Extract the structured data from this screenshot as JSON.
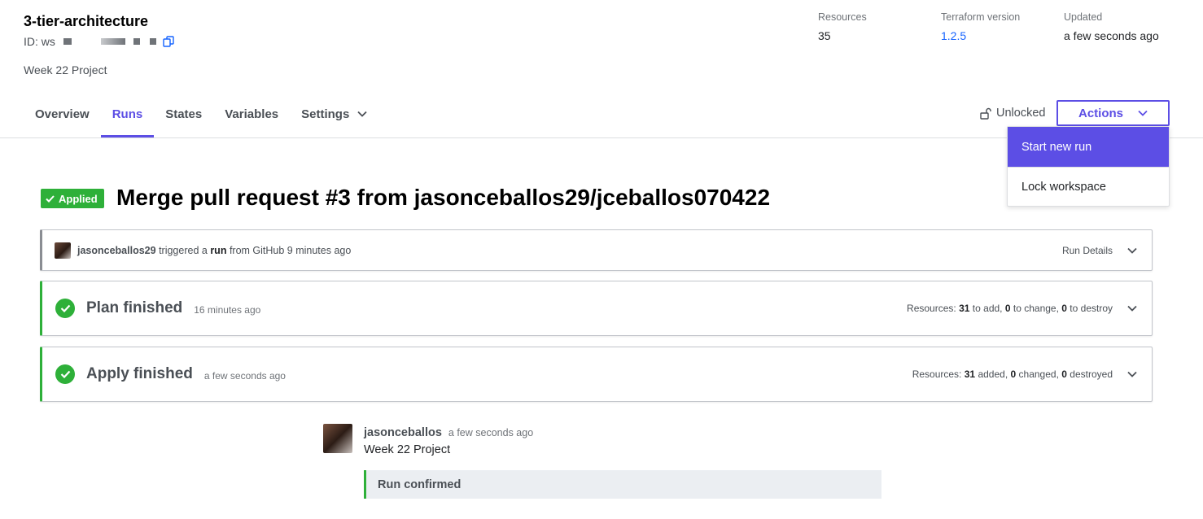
{
  "workspace": {
    "name": "3-tier-architecture",
    "id_prefix": "ID: ws",
    "description": "Week 22 Project"
  },
  "meta": {
    "resources_label": "Resources",
    "resources_value": "35",
    "terraform_label": "Terraform version",
    "terraform_value": "1.2.5",
    "updated_label": "Updated",
    "updated_value": "a few seconds ago"
  },
  "tabs": [
    {
      "label": "Overview"
    },
    {
      "label": "Runs",
      "active": true
    },
    {
      "label": "States"
    },
    {
      "label": "Variables"
    },
    {
      "label": "Settings"
    }
  ],
  "lock_status": "Unlocked",
  "actions": {
    "label": "Actions",
    "menu": [
      {
        "label": "Start new run"
      },
      {
        "label": "Lock workspace"
      }
    ]
  },
  "run": {
    "status": "Applied",
    "title": "Merge pull request #3 from jasonceballos29/jceballos070422"
  },
  "trigger": {
    "user": "jasonceballos29",
    "text1": "triggered a",
    "run_word": "run",
    "text2": "from GitHub 9 minutes ago",
    "details_label": "Run Details"
  },
  "plan": {
    "title": "Plan finished",
    "time": "16 minutes ago",
    "prefix": "Resources:",
    "add": "31",
    "add_label": "to add,",
    "change": "0",
    "change_label": "to change,",
    "destroy": "0",
    "destroy_label": "to destroy"
  },
  "apply": {
    "title": "Apply finished",
    "time": "a few seconds ago",
    "prefix": "Resources:",
    "added": "31",
    "added_label": "added,",
    "changed": "0",
    "changed_label": "changed,",
    "destroyed": "0",
    "destroyed_label": "destroyed"
  },
  "comment": {
    "user": "jasonceballos",
    "time": "a few seconds ago",
    "text": "Week 22 Project",
    "confirmation": "Run confirmed"
  },
  "colors": {
    "accent": "#5c4ee5",
    "success": "#2eb039",
    "link": "#1563ff"
  }
}
